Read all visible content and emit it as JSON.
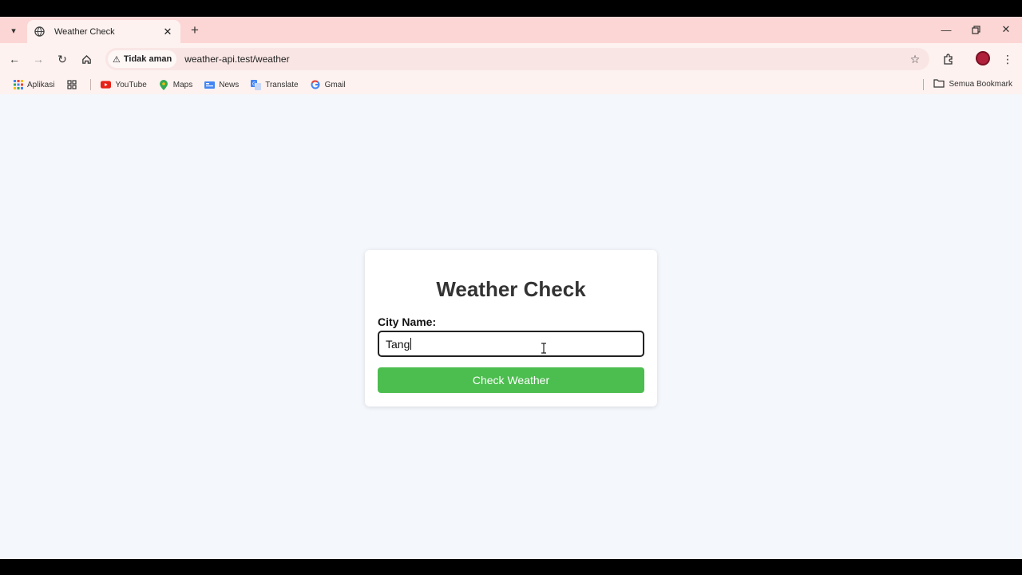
{
  "browser": {
    "tab": {
      "title": "Weather Check"
    },
    "address": {
      "security_label": "Tidak aman",
      "url": "weather-api.test/weather"
    },
    "bookmarks": [
      {
        "label": "Aplikasi",
        "icon": "apps-grid-icon"
      },
      {
        "label": "YouTube",
        "icon": "youtube-icon"
      },
      {
        "label": "Maps",
        "icon": "maps-pin-icon"
      },
      {
        "label": "News",
        "icon": "news-icon"
      },
      {
        "label": "Translate",
        "icon": "translate-icon"
      },
      {
        "label": "Gmail",
        "icon": "google-icon"
      }
    ],
    "all_bookmarks": "Semua Bookmark",
    "colors": {
      "tabstrip": "#fcd6d4",
      "toolbar": "#fdf2f0",
      "avatar": "#b0203a"
    }
  },
  "page": {
    "title": "Weather Check",
    "city_label": "City Name:",
    "city_value": "Tang",
    "submit_label": "Check Weather",
    "colors": {
      "button": "#4cbd4f",
      "background": "#f4f7fb"
    }
  }
}
